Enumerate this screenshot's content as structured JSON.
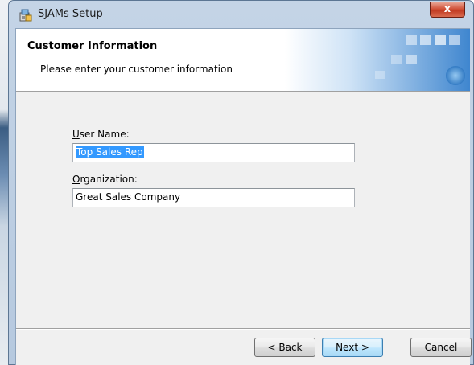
{
  "window": {
    "title": "SJAMs Setup",
    "close_glyph": "x",
    "icon": "installer-icon"
  },
  "header": {
    "title": "Customer Information",
    "subtitle": "Please enter your customer information"
  },
  "form": {
    "user_name_label_accel": "U",
    "user_name_label_rest": "ser Name:",
    "user_name_value": "Top Sales Rep",
    "organization_label_accel": "O",
    "organization_label_rest": "rganization:",
    "organization_value": "Great Sales Company"
  },
  "buttons": {
    "back": "< Back",
    "next": "Next >",
    "cancel": "Cancel"
  },
  "colors": {
    "selection": "#3399ff",
    "close_button": "#c13a22",
    "default_button_border": "#3c7fb1"
  }
}
